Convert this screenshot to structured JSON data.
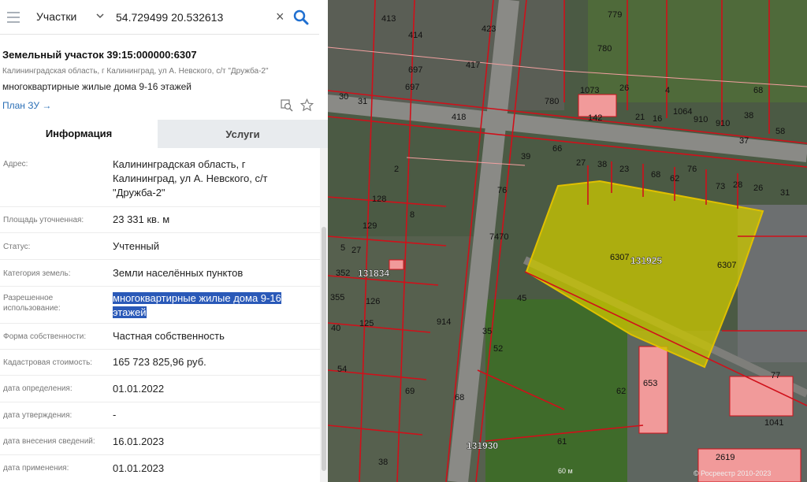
{
  "search": {
    "type_label": "Участки",
    "query": "54.729499 20.532613"
  },
  "plot": {
    "title": "Земельный участок 39:15:000000:6307",
    "address_short": "Калининградская область, г Калининград, ул А. Невского, с/т \"Дружба-2\"",
    "use": "многоквартирные жилые дома 9-16 этажей",
    "plan_link": "План ЗУ →"
  },
  "tabs": [
    {
      "label": "Информация"
    },
    {
      "label": "Услуги"
    }
  ],
  "info": [
    {
      "label": "Адрес:",
      "value": "Калининградская область, г Калининград, ул А. Невского, с/т \"Дружба-2\""
    },
    {
      "label": "Площадь уточненная:",
      "value": "23 331 кв. м"
    },
    {
      "label": "Статус:",
      "value": "Учтенный"
    },
    {
      "label": "Категория земель:",
      "value": "Земли населённых пунктов"
    },
    {
      "label": "Разрешенное использование:",
      "value": "многоквартирные жилые дома 9-16 этажей"
    },
    {
      "label": "Форма собственности:",
      "value": "Частная собственность"
    },
    {
      "label": "Кадастровая стоимость:",
      "value": "165 723 825,96 руб."
    },
    {
      "label": "дата определения:",
      "value": "01.01.2022"
    },
    {
      "label": "дата утверждения:",
      "value": "-"
    },
    {
      "label": "дата внесения сведений:",
      "value": "16.01.2023"
    },
    {
      "label": "дата применения:",
      "value": "01.01.2023"
    }
  ],
  "map": {
    "parcel_labels": [
      "413",
      "414",
      "423",
      "779",
      "697",
      "417",
      "780",
      "697",
      "30",
      "31",
      "418",
      "780",
      "1073",
      "26",
      "4",
      "68",
      "21",
      "16",
      "1064",
      "910",
      "910",
      "38",
      "58",
      "142",
      "66",
      "39",
      "37",
      "2",
      "27",
      "38",
      "23",
      "68",
      "62",
      "76",
      "73",
      "28",
      "26",
      "31",
      "128",
      "8",
      "76",
      "129",
      "7470",
      "6307",
      "131925",
      "6307",
      "5",
      "27",
      "352",
      "131834",
      "355",
      "126",
      "45",
      "914",
      "125",
      "40",
      "35",
      "52",
      "54",
      "69",
      "68",
      "62",
      "653",
      "77",
      "131930",
      "61",
      "1041",
      "2619",
      "38"
    ],
    "scale_label": "60 м",
    "attribution": "© Росреестр 2010-2023"
  },
  "colors": {
    "accent": "#2d5f9a",
    "link": "#2b6fb6",
    "selection": "#2a59b8",
    "parcel_fill": "#c8c400",
    "boundary": "#d0101a"
  }
}
